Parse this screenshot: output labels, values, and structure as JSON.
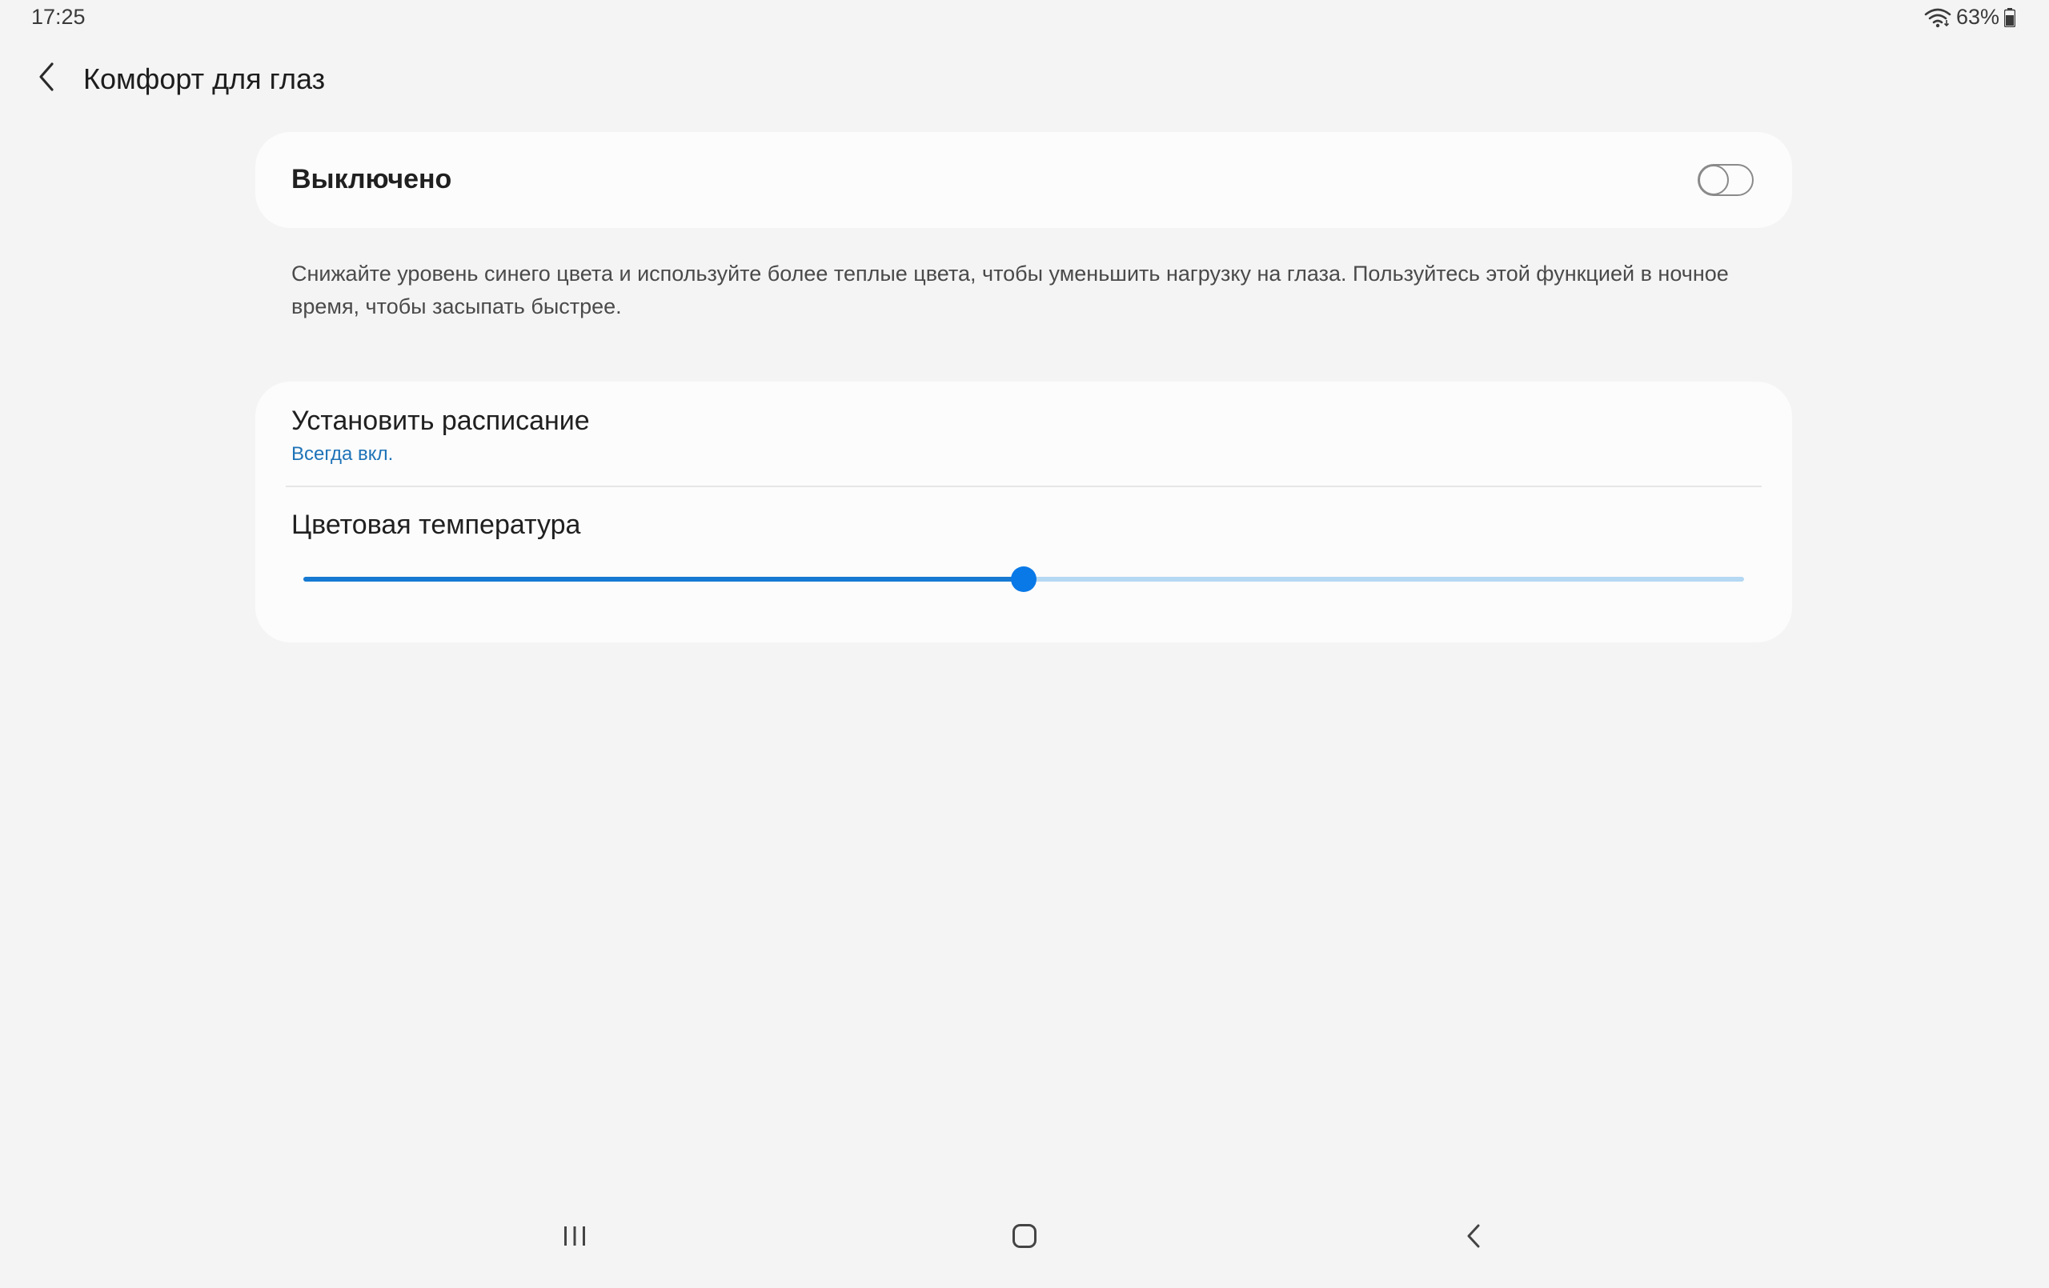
{
  "status_bar": {
    "time": "17:25",
    "battery_percent": "63%"
  },
  "header": {
    "title": "Комфорт для глаз"
  },
  "main_toggle": {
    "label": "Выключено",
    "checked": false
  },
  "description": "Снижайте уровень синего цвета и используйте более теплые цвета, чтобы уменьшить нагрузку на глаза. Пользуйтесь этой функцией в ночное время, чтобы засыпать быстрее.",
  "schedule": {
    "title": "Установить расписание",
    "value": "Всегда вкл."
  },
  "color_temperature": {
    "title": "Цветовая температура",
    "value_fraction": 0.5
  },
  "colors": {
    "accent": "#0a79e8",
    "track_fill": "#1679d2",
    "track_bg": "#b5d8f3",
    "link": "#1e73b8",
    "background": "#f4f4f4",
    "card": "#fcfcfc"
  },
  "icons": {
    "back": "chevron-left-icon",
    "wifi": "wifi-icon",
    "battery": "battery-icon",
    "nav_recents": "recents-icon",
    "nav_home": "home-icon",
    "nav_back": "back-icon"
  }
}
